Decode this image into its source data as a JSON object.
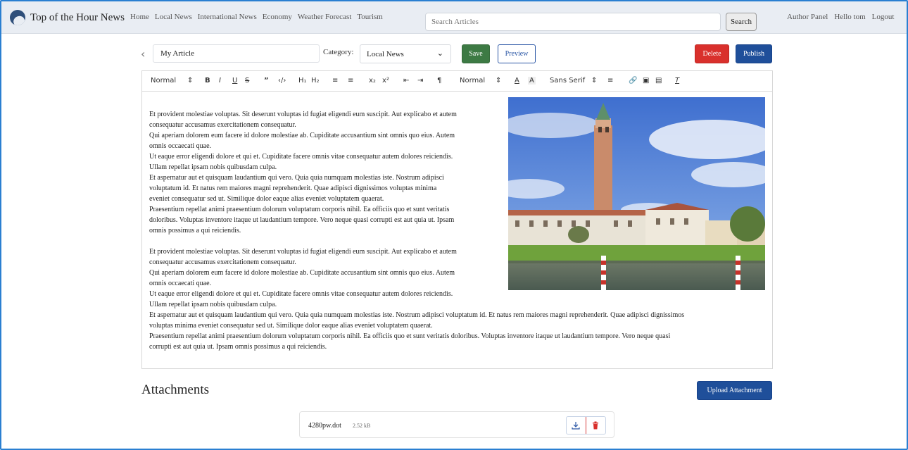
{
  "navbar": {
    "brand": "Top of the Hour News",
    "links": [
      "Home",
      "Local News",
      "International News",
      "Economy",
      "Weather Forecast",
      "Tourism"
    ],
    "search_placeholder": "Search Articles",
    "search_button": "Search",
    "author_panel": "Author Panel",
    "greeting": "Hello tom",
    "logout": "Logout"
  },
  "article": {
    "title_value": "My Article",
    "category_label": "Category:",
    "category_value": "Local News"
  },
  "actions": {
    "save": "Save",
    "preview": "Preview",
    "delete": "Delete",
    "publish": "Publish"
  },
  "toolbar": {
    "heading_select": "Normal",
    "size_select": "Normal",
    "font_select": "Sans Serif"
  },
  "editor": {
    "lines": [
      "Et provident molestiae voluptas. Sit deserunt voluptas id fugiat eligendi eum suscipit. Aut explicabo et autem",
      "consequatur accusamus exercitationem consequatur.",
      "Qui aperiam dolorem eum facere id dolore molestiae ab. Cupiditate accusantium sint omnis quo eius. Autem",
      "omnis occaecati quae.",
      "Ut eaque error eligendi dolore et qui et. Cupiditate facere omnis vitae consequatur autem dolores reiciendis.",
      "Ullam repellat ipsam nobis quibusdam culpa.",
      "Et aspernatur aut et quisquam laudantium qui vero. Quia quia numquam molestias iste. Nostrum adipisci",
      "voluptatum id. Et natus rem maiores magni reprehenderit. Quae adipisci dignissimos voluptas minima",
      "eveniet consequatur sed ut. Similique dolor eaque alias eveniet voluptatem quaerat.",
      "Praesentium repellat animi praesentium dolorum voluptatum corporis nihil. Ea officiis quo et sunt veritatis",
      "doloribus. Voluptas inventore itaque ut laudantium tempore. Vero neque quasi corrupti est aut quia ut. Ipsam",
      "omnis possimus a qui reiciendis.",
      "",
      "Et provident molestiae voluptas. Sit deserunt voluptas id fugiat eligendi eum suscipit. Aut explicabo et autem",
      "consequatur accusamus exercitationem consequatur.",
      "Qui aperiam dolorem eum facere id dolore molestiae ab. Cupiditate accusantium sint omnis quo eius. Autem",
      "omnis occaecati quae.",
      "Ut eaque error eligendi dolore et qui et. Cupiditate facere omnis vitae consequatur autem dolores reiciendis.",
      "Ullam repellat ipsam nobis quibusdam culpa.",
      "Et aspernatur aut et quisquam laudantium qui vero. Quia quia numquam molestias iste. Nostrum adipisci voluptatum id. Et natus rem maiores magni reprehenderit. Quae adipisci dignissimos",
      "voluptas minima eveniet consequatur sed ut. Similique dolor eaque alias eveniet voluptatem quaerat.",
      "Praesentium repellat animi praesentium dolorum voluptatum corporis nihil. Ea officiis quo et sunt veritatis doloribus. Voluptas inventore itaque ut laudantium tempore. Vero neque quasi",
      "corrupti est aut quia ut. Ipsam omnis possimus a qui reiciendis."
    ]
  },
  "attachments": {
    "title": "Attachments",
    "upload_button": "Upload Attachment",
    "items": [
      {
        "name": "4280pw.dot",
        "size": "2.52 kB"
      }
    ]
  },
  "colors": {
    "navbar_bg": "#e9edf3",
    "save": "#3d7a44",
    "delete": "#d9302c",
    "publish": "#1f4f9a",
    "frame": "#2a7fd1"
  }
}
